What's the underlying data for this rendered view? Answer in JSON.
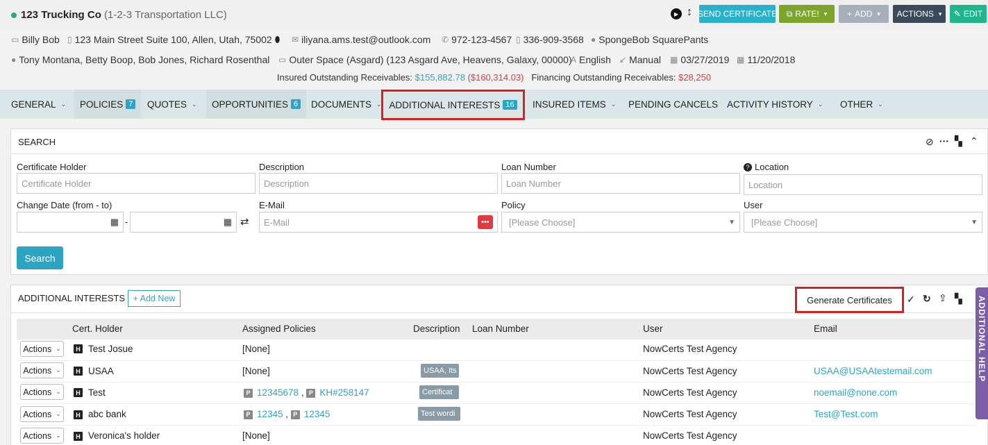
{
  "client": {
    "name": "123 Trucking Co",
    "dba": "(1-2-3 Transportation LLC)"
  },
  "toolbar": {
    "send": "SEND CERTIFICATE",
    "rate": "RATE!",
    "add": "ADD",
    "actions": "ACTIONS",
    "edit": "EDIT"
  },
  "info": {
    "contact": "Billy Bob",
    "address": "123 Main Street Suite 100, Allen, Utah, 75002",
    "email": "iliyana.ams.test@outlook.com",
    "phone": "972-123-4567",
    "mobile": "336-909-3568",
    "agent": "SpongeBob SquarePants",
    "agents": "Tony Montana, Betty Boop, Bob Jones, Richard Rosenthal",
    "location": "Outer Space (Asgard) (123 Asgard Ave, Heavens, Galaxy, 00000)",
    "language": "English",
    "source": "Manual",
    "date1": "03/27/2019",
    "date2": "11/20/2018"
  },
  "receivables": {
    "insured_label": "Insured Outstanding Receivables:",
    "insured_value": "$155,882.78",
    "insured_neg": "($160,314.03)",
    "financing_label": "Financing Outstanding Receivables:",
    "financing_value": "$28,250"
  },
  "nav": [
    {
      "label": "GENERAL",
      "badge": ""
    },
    {
      "label": "POLICIES",
      "badge": "7"
    },
    {
      "label": "QUOTES",
      "badge": ""
    },
    {
      "label": "OPPORTUNITIES",
      "badge": "6"
    },
    {
      "label": "DOCUMENTS",
      "badge": ""
    },
    {
      "label": "ADDITIONAL INTERESTS",
      "badge": "16"
    },
    {
      "label": "INSURED ITEMS",
      "badge": ""
    },
    {
      "label": "PENDING CANCELS",
      "badge": ""
    },
    {
      "label": "ACTIVITY HISTORY",
      "badge": ""
    },
    {
      "label": "OTHER",
      "badge": ""
    }
  ],
  "search": {
    "title": "SEARCH",
    "button": "Search",
    "fields": {
      "cert_holder": {
        "label": "Certificate Holder",
        "placeholder": "Certificate Holder"
      },
      "description": {
        "label": "Description",
        "placeholder": "Description"
      },
      "loan": {
        "label": "Loan Number",
        "placeholder": "Loan Number"
      },
      "location": {
        "label": "Location",
        "placeholder": "Location"
      },
      "change_date": {
        "label": "Change Date (from - to)",
        "sep": "-"
      },
      "email": {
        "label": "E-Mail",
        "placeholder": "E-Mail"
      },
      "policy": {
        "label": "Policy",
        "placeholder": "[Please Choose]"
      },
      "user": {
        "label": "User",
        "placeholder": "[Please Choose]"
      }
    }
  },
  "ai": {
    "title": "ADDITIONAL INTERESTS",
    "add_new": "+ Add New",
    "generate": "Generate Certificates",
    "help": "ADDITIONAL HELP",
    "columns": [
      "Cert. Holder",
      "Assigned Policies",
      "Description",
      "Loan Number",
      "User",
      "Email"
    ],
    "action_label": "Actions",
    "rows": [
      {
        "holder": "Test Josue",
        "policies": "[None]",
        "p1": "",
        "p2": "",
        "desc": "",
        "user": "NowCerts Test Agency",
        "email": ""
      },
      {
        "holder": "USAA",
        "policies": "[None]",
        "p1": "",
        "p2": "",
        "desc": "USAA, Its",
        "user": "NowCerts Test Agency",
        "email": "USAA@USAAtestemail.com"
      },
      {
        "holder": "Test",
        "policies": "",
        "p1": "12345678",
        "p2": "KH#258147",
        "desc": "Certificat",
        "user": "NowCerts Test Agency",
        "email": "noemail@none.com"
      },
      {
        "holder": "abc bank",
        "policies": "",
        "p1": "12345",
        "p2": "12345",
        "desc": "Test wordi",
        "user": "NowCerts Test Agency",
        "email": "Test@Test.com"
      },
      {
        "holder": "Veronica's holder",
        "policies": "[None]",
        "p1": "",
        "p2": "",
        "desc": "",
        "user": "NowCerts Test Agency",
        "email": ""
      }
    ]
  }
}
